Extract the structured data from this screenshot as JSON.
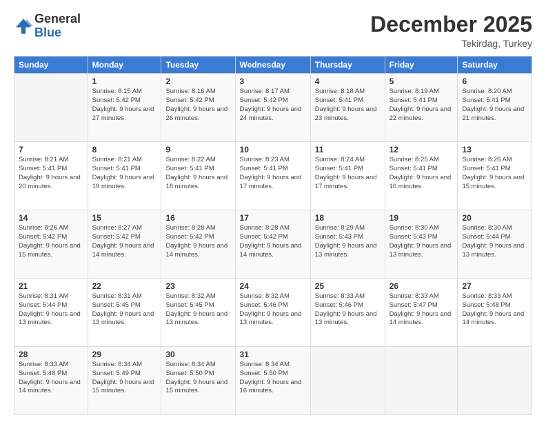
{
  "logo": {
    "general": "General",
    "blue": "Blue"
  },
  "header": {
    "month": "December 2025",
    "location": "Tekirdag, Turkey"
  },
  "weekdays": [
    "Sunday",
    "Monday",
    "Tuesday",
    "Wednesday",
    "Thursday",
    "Friday",
    "Saturday"
  ],
  "weeks": [
    [
      {
        "day": "",
        "sunrise": "",
        "sunset": "",
        "daylight": ""
      },
      {
        "day": "1",
        "sunrise": "Sunrise: 8:15 AM",
        "sunset": "Sunset: 5:42 PM",
        "daylight": "Daylight: 9 hours and 27 minutes."
      },
      {
        "day": "2",
        "sunrise": "Sunrise: 8:16 AM",
        "sunset": "Sunset: 5:42 PM",
        "daylight": "Daylight: 9 hours and 26 minutes."
      },
      {
        "day": "3",
        "sunrise": "Sunrise: 8:17 AM",
        "sunset": "Sunset: 5:42 PM",
        "daylight": "Daylight: 9 hours and 24 minutes."
      },
      {
        "day": "4",
        "sunrise": "Sunrise: 8:18 AM",
        "sunset": "Sunset: 5:41 PM",
        "daylight": "Daylight: 9 hours and 23 minutes."
      },
      {
        "day": "5",
        "sunrise": "Sunrise: 8:19 AM",
        "sunset": "Sunset: 5:41 PM",
        "daylight": "Daylight: 9 hours and 22 minutes."
      },
      {
        "day": "6",
        "sunrise": "Sunrise: 8:20 AM",
        "sunset": "Sunset: 5:41 PM",
        "daylight": "Daylight: 9 hours and 21 minutes."
      }
    ],
    [
      {
        "day": "7",
        "sunrise": "Sunrise: 8:21 AM",
        "sunset": "Sunset: 5:41 PM",
        "daylight": "Daylight: 9 hours and 20 minutes."
      },
      {
        "day": "8",
        "sunrise": "Sunrise: 8:21 AM",
        "sunset": "Sunset: 5:41 PM",
        "daylight": "Daylight: 9 hours and 19 minutes."
      },
      {
        "day": "9",
        "sunrise": "Sunrise: 8:22 AM",
        "sunset": "Sunset: 5:41 PM",
        "daylight": "Daylight: 9 hours and 18 minutes."
      },
      {
        "day": "10",
        "sunrise": "Sunrise: 8:23 AM",
        "sunset": "Sunset: 5:41 PM",
        "daylight": "Daylight: 9 hours and 17 minutes."
      },
      {
        "day": "11",
        "sunrise": "Sunrise: 8:24 AM",
        "sunset": "Sunset: 5:41 PM",
        "daylight": "Daylight: 9 hours and 17 minutes."
      },
      {
        "day": "12",
        "sunrise": "Sunrise: 8:25 AM",
        "sunset": "Sunset: 5:41 PM",
        "daylight": "Daylight: 9 hours and 16 minutes."
      },
      {
        "day": "13",
        "sunrise": "Sunrise: 8:26 AM",
        "sunset": "Sunset: 5:41 PM",
        "daylight": "Daylight: 9 hours and 15 minutes."
      }
    ],
    [
      {
        "day": "14",
        "sunrise": "Sunrise: 8:26 AM",
        "sunset": "Sunset: 5:42 PM",
        "daylight": "Daylight: 9 hours and 15 minutes."
      },
      {
        "day": "15",
        "sunrise": "Sunrise: 8:27 AM",
        "sunset": "Sunset: 5:42 PM",
        "daylight": "Daylight: 9 hours and 14 minutes."
      },
      {
        "day": "16",
        "sunrise": "Sunrise: 8:28 AM",
        "sunset": "Sunset: 5:42 PM",
        "daylight": "Daylight: 9 hours and 14 minutes."
      },
      {
        "day": "17",
        "sunrise": "Sunrise: 8:28 AM",
        "sunset": "Sunset: 5:42 PM",
        "daylight": "Daylight: 9 hours and 14 minutes."
      },
      {
        "day": "18",
        "sunrise": "Sunrise: 8:29 AM",
        "sunset": "Sunset: 5:43 PM",
        "daylight": "Daylight: 9 hours and 13 minutes."
      },
      {
        "day": "19",
        "sunrise": "Sunrise: 8:30 AM",
        "sunset": "Sunset: 5:43 PM",
        "daylight": "Daylight: 9 hours and 13 minutes."
      },
      {
        "day": "20",
        "sunrise": "Sunrise: 8:30 AM",
        "sunset": "Sunset: 5:44 PM",
        "daylight": "Daylight: 9 hours and 13 minutes."
      }
    ],
    [
      {
        "day": "21",
        "sunrise": "Sunrise: 8:31 AM",
        "sunset": "Sunset: 5:44 PM",
        "daylight": "Daylight: 9 hours and 13 minutes."
      },
      {
        "day": "22",
        "sunrise": "Sunrise: 8:31 AM",
        "sunset": "Sunset: 5:45 PM",
        "daylight": "Daylight: 9 hours and 13 minutes."
      },
      {
        "day": "23",
        "sunrise": "Sunrise: 8:32 AM",
        "sunset": "Sunset: 5:45 PM",
        "daylight": "Daylight: 9 hours and 13 minutes."
      },
      {
        "day": "24",
        "sunrise": "Sunrise: 8:32 AM",
        "sunset": "Sunset: 5:46 PM",
        "daylight": "Daylight: 9 hours and 13 minutes."
      },
      {
        "day": "25",
        "sunrise": "Sunrise: 8:33 AM",
        "sunset": "Sunset: 5:46 PM",
        "daylight": "Daylight: 9 hours and 13 minutes."
      },
      {
        "day": "26",
        "sunrise": "Sunrise: 8:33 AM",
        "sunset": "Sunset: 5:47 PM",
        "daylight": "Daylight: 9 hours and 14 minutes."
      },
      {
        "day": "27",
        "sunrise": "Sunrise: 8:33 AM",
        "sunset": "Sunset: 5:48 PM",
        "daylight": "Daylight: 9 hours and 14 minutes."
      }
    ],
    [
      {
        "day": "28",
        "sunrise": "Sunrise: 8:33 AM",
        "sunset": "Sunset: 5:48 PM",
        "daylight": "Daylight: 9 hours and 14 minutes."
      },
      {
        "day": "29",
        "sunrise": "Sunrise: 8:34 AM",
        "sunset": "Sunset: 5:49 PM",
        "daylight": "Daylight: 9 hours and 15 minutes."
      },
      {
        "day": "30",
        "sunrise": "Sunrise: 8:34 AM",
        "sunset": "Sunset: 5:50 PM",
        "daylight": "Daylight: 9 hours and 15 minutes."
      },
      {
        "day": "31",
        "sunrise": "Sunrise: 8:34 AM",
        "sunset": "Sunset: 5:50 PM",
        "daylight": "Daylight: 9 hours and 16 minutes."
      },
      {
        "day": "",
        "sunrise": "",
        "sunset": "",
        "daylight": ""
      },
      {
        "day": "",
        "sunrise": "",
        "sunset": "",
        "daylight": ""
      },
      {
        "day": "",
        "sunrise": "",
        "sunset": "",
        "daylight": ""
      }
    ]
  ]
}
